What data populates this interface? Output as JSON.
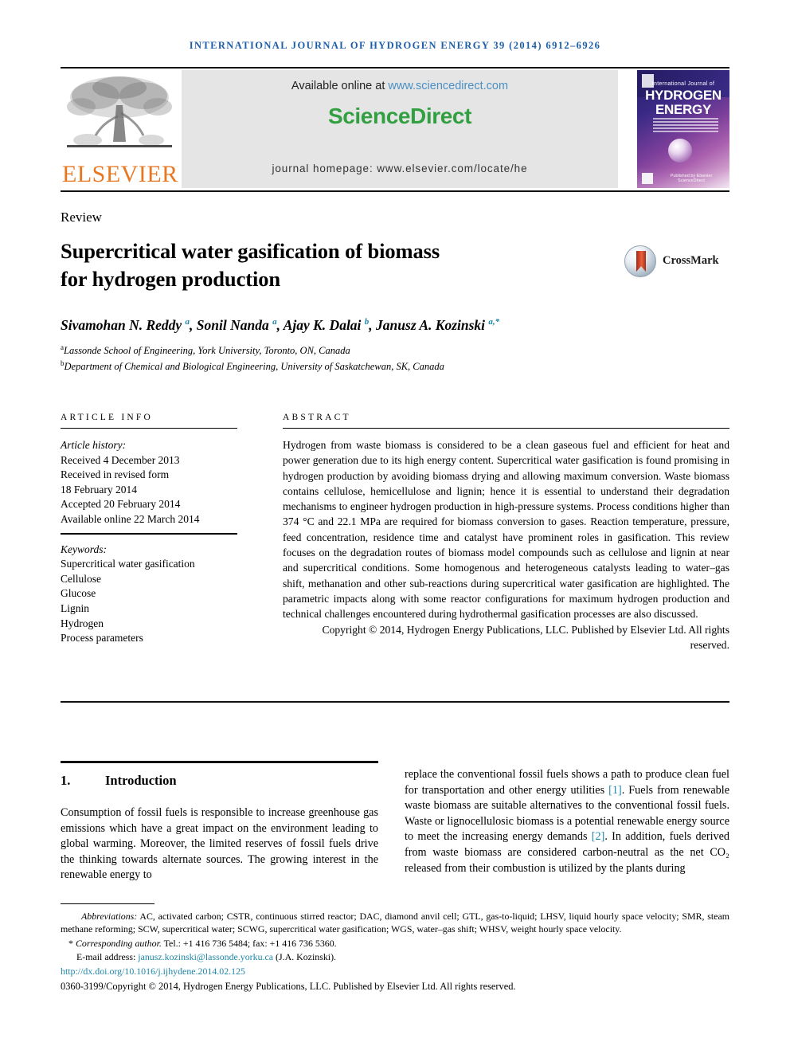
{
  "running_head": "International Journal of Hydrogen Energy 39 (2014) 6912–6926",
  "masthead": {
    "publisher_name": "ELSEVIER",
    "available_prefix": "Available online at ",
    "available_link": "www.sciencedirect.com",
    "sciencedirect_logo": "ScienceDirect",
    "journal_homepage": "journal homepage: www.elsevier.com/locate/he",
    "cover": {
      "line1": "International Journal of",
      "line2": "HYDROGEN",
      "line3": "ENERGY",
      "footer": "Published by Elsevier  ScienceDirect"
    }
  },
  "article": {
    "type": "Review",
    "title_line1": "Supercritical water gasification of biomass",
    "title_line2": "for hydrogen production",
    "crossmark_label": "CrossMark",
    "authors_html": "Sivamohan N. Reddy <sup>a</sup>, Sonil Nanda <sup>a</sup>, Ajay K. Dalai <sup>b</sup>, Janusz A. Kozinski <sup>a,*</sup>",
    "affiliations": [
      {
        "marker": "a",
        "text": "Lassonde School of Engineering, York University, Toronto, ON, Canada"
      },
      {
        "marker": "b",
        "text": "Department of Chemical and Biological Engineering, University of Saskatchewan, SK, Canada"
      }
    ]
  },
  "article_info": {
    "heading": "Article info",
    "history_label": "Article history:",
    "history": [
      "Received 4 December 2013",
      "Received in revised form",
      "18 February 2014",
      "Accepted 20 February 2014",
      "Available online 22 March 2014"
    ],
    "keywords_label": "Keywords:",
    "keywords": [
      "Supercritical water gasification",
      "Cellulose",
      "Glucose",
      "Lignin",
      "Hydrogen",
      "Process parameters"
    ]
  },
  "abstract": {
    "heading": "Abstract",
    "body": "Hydrogen from waste biomass is considered to be a clean gaseous fuel and efficient for heat and power generation due to its high energy content. Supercritical water gasification is found promising in hydrogen production by avoiding biomass drying and allowing maximum conversion. Waste biomass contains cellulose, hemicellulose and lignin; hence it is essential to understand their degradation mechanisms to engineer hydrogen production in high-pressure systems. Process conditions higher than 374 °C and 22.1 MPa are required for biomass conversion to gases. Reaction temperature, pressure, feed concentration, residence time and catalyst have prominent roles in gasification. This review focuses on the degradation routes of biomass model compounds such as cellulose and lignin at near and supercritical conditions. Some homogenous and heterogeneous catalysts leading to water–gas shift, methanation and other sub-reactions during supercritical water gasification are highlighted. The parametric impacts along with some reactor configurations for maximum hydrogen production and technical challenges encountered during hydrothermal gasification processes are also discussed.",
    "copyright": "Copyright © 2014, Hydrogen Energy Publications, LLC. Published by Elsevier Ltd. All rights reserved."
  },
  "body": {
    "section_number": "1.",
    "section_title": "Introduction",
    "left_paragraph": "Consumption of fossil fuels is responsible to increase greenhouse gas emissions which have a great impact on the environment leading to global warming. Moreover, the limited reserves of fossil fuels drive the thinking towards alternate sources. The growing interest in the renewable energy to",
    "right_paragraph_part1": "replace the conventional fossil fuels shows a path to produce clean fuel for transportation and other energy utilities ",
    "right_ref1": "[1]",
    "right_paragraph_part2": ". Fuels from renewable waste biomass are suitable alternatives to the conventional fossil fuels. Waste or lignocellulosic biomass is a potential renewable energy source to meet the increasing energy demands ",
    "right_ref2": "[2]",
    "right_paragraph_part3": ". In addition, fuels derived from waste biomass are considered carbon-neutral as the net CO₂ released from their combustion is utilized by the plants during"
  },
  "footnotes": {
    "abbreviations_label": "Abbreviations:",
    "abbreviations_text": " AC, activated carbon; CSTR, continuous stirred reactor; DAC, diamond anvil cell; GTL, gas-to-liquid; LHSV, liquid hourly space velocity; SMR, steam methane reforming; SCW, supercritical water; SCWG, supercritical water gasification; WGS, water–gas shift; WHSV, weight hourly space velocity.",
    "corresponding_marker": "*",
    "corresponding_label": "Corresponding author.",
    "corresponding_text": " Tel.: +1 416 736 5484; fax: +1 416 736 5360.",
    "email_label": "E-mail address: ",
    "email_address": "janusz.kozinski@lassonde.yorku.ca",
    "email_suffix": " (J.A. Kozinski).",
    "doi": "http://dx.doi.org/10.1016/j.ijhydene.2014.02.125",
    "issn_copyright": "0360-3199/Copyright © 2014, Hydrogen Energy Publications, LLC. Published by Elsevier Ltd. All rights reserved."
  },
  "colors": {
    "runhead_blue": "#1d5ea8",
    "link_blue": "#1f85a8",
    "sciencedirect_green": "#32a041",
    "elsevier_orange": "#e87722",
    "sd_link_blue": "#4a90c4"
  }
}
